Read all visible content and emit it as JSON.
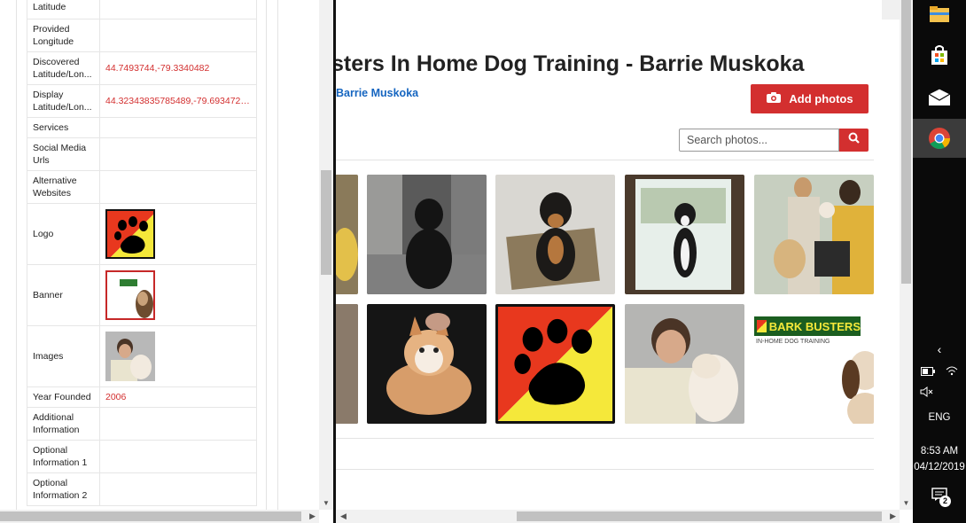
{
  "details": {
    "rows": [
      {
        "label": "Latitude",
        "value": ""
      },
      {
        "label": "Provided Longitude",
        "value": ""
      },
      {
        "label": "Discovered Latitude/Lon...",
        "value": "44.7493744,-79.3340482"
      },
      {
        "label": "Display Latitude/Lon...",
        "value": "44.32343835785489,-79.6934726..."
      },
      {
        "label": "Services",
        "value": ""
      },
      {
        "label": "Social Media Urls",
        "value": ""
      },
      {
        "label": "Alternative Websites",
        "value": ""
      },
      {
        "label": "Logo",
        "value": ""
      },
      {
        "label": "Banner",
        "value": ""
      },
      {
        "label": "Images",
        "value": ""
      },
      {
        "label": "Year Founded",
        "value": "2006"
      },
      {
        "label": "Additional Information",
        "value": ""
      },
      {
        "label": "Optional Information 1",
        "value": ""
      },
      {
        "label": "Optional Information 2",
        "value": ""
      }
    ]
  },
  "listing": {
    "title": "sters In Home Dog Training - Barrie Muskoka",
    "location": "Barrie Muskoka",
    "add_photos_label": "Add photos",
    "search_placeholder": "Search photos..."
  },
  "photos": [
    {
      "name": "photo-partial-1",
      "desc": "cropped photo"
    },
    {
      "name": "photo-black-dog-kitchen",
      "desc": "black dog in kitchen"
    },
    {
      "name": "photo-rottweiler-mix-rug",
      "desc": "dog on rug"
    },
    {
      "name": "photo-boston-terrier-door",
      "desc": "dog at glass door"
    },
    {
      "name": "photo-trainers-with-dogs",
      "desc": "people with dogs"
    },
    {
      "name": "photo-partial-2",
      "desc": "cropped photo"
    },
    {
      "name": "photo-husky-puppy",
      "desc": "fluffy puppy"
    },
    {
      "name": "photo-paw-logo",
      "desc": "paw logo"
    },
    {
      "name": "photo-trainer-kiss",
      "desc": "trainer with dog"
    },
    {
      "name": "photo-bark-busters-banner",
      "desc": "banner"
    }
  ],
  "banner_logo": {
    "line1": "BARK BUSTERS",
    "line2": "IN-HOME DOG TRAINING"
  },
  "taskbar": {
    "language": "ENG",
    "time": "8:53 AM",
    "date": "04/12/2019",
    "notification_count": "2"
  },
  "colors": {
    "accent_red": "#d32f2f",
    "link_blue": "#1565c0",
    "value_red": "#d32f2f",
    "taskbar_bg": "#0a0a0a"
  }
}
